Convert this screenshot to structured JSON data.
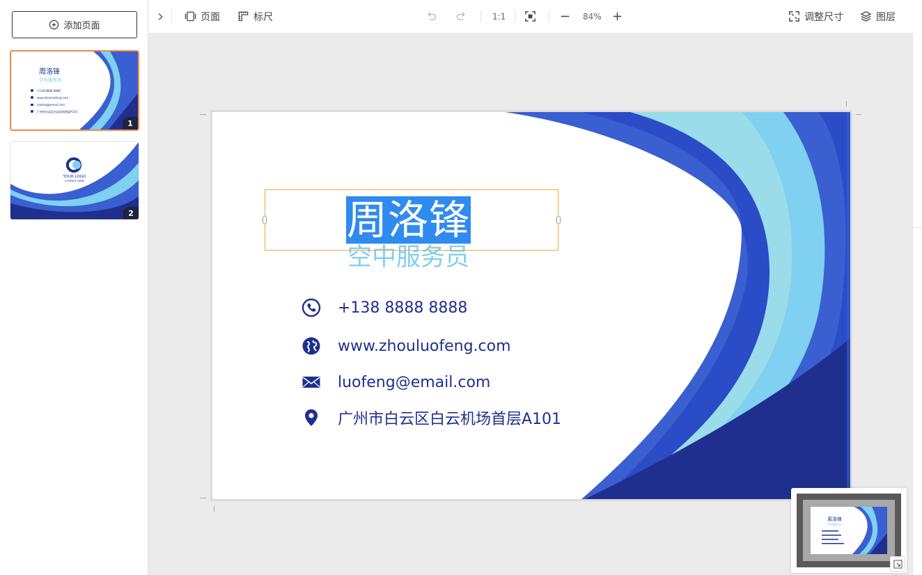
{
  "sidebar": {
    "add_page_label": "添加页面",
    "pages": [
      {
        "number": "1",
        "name": "周洛锋",
        "title": "空中服务员",
        "selected": true,
        "lines": [
          "+138 8888 8888",
          "www.zhouluofeng.com",
          "luofeng@email.com",
          "广州市白云区白云机场首层A101"
        ]
      },
      {
        "number": "2",
        "logo_text": "YOUR LOGO",
        "logo_sub": "COMPANY NAME",
        "selected": false
      }
    ]
  },
  "toolbar": {
    "page_label": "页面",
    "ruler_label": "标尺",
    "ratio_label": "1:1",
    "zoom_level": "84%",
    "resize_label": "调整尺寸",
    "layers_label": "图层"
  },
  "card": {
    "name": "周洛锋",
    "title": "空中服务员",
    "contacts": {
      "phone": "+138 8888 8888",
      "website": "www.zhouluofeng.com",
      "email": "luofeng@email.com",
      "address": "广州市白云区白云机场首层A101"
    }
  },
  "colors": {
    "navy": "#1e2f8e",
    "royal_blue": "#3a5fd0",
    "light_blue": "#7fd0f1",
    "sky": "#9adcea",
    "selection_text_bg": "#2f8bef",
    "selection_frame": "#f3a63c",
    "thumb_selected_border": "#f08a3e"
  }
}
